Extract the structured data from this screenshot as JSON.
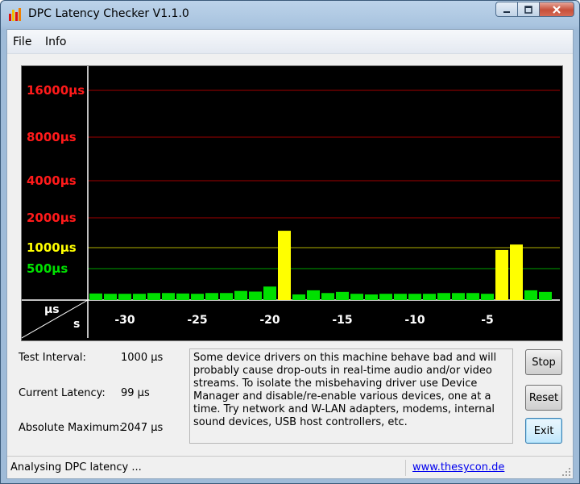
{
  "window": {
    "title": "DPC Latency Checker V1.1.0"
  },
  "menu": {
    "items": [
      "File",
      "Info"
    ]
  },
  "chart_data": {
    "type": "bar",
    "title": "",
    "y_scale": "log",
    "y_tick_labels": [
      "16000µs",
      "8000µs",
      "4000µs",
      "2000µs",
      "1000µs",
      "500µs"
    ],
    "y_ticks": [
      16000,
      8000,
      4000,
      2000,
      1000,
      500
    ],
    "y_tick_colors": [
      "#ff1a1a",
      "#ff1a1a",
      "#ff1a1a",
      "#ff1a1a",
      "#ffff00",
      "#00e000"
    ],
    "x_ticks": [
      -30,
      -25,
      -20,
      -15,
      -10,
      -5
    ],
    "x_tick_labels": [
      "-30",
      "-25",
      "-20",
      "-15",
      "-10",
      "-5"
    ],
    "corner_labels": {
      "y": "µs",
      "x": "s"
    },
    "x": [
      -33,
      -32,
      -31,
      -30,
      -29,
      -28,
      -27,
      -26,
      -25,
      -24,
      -23,
      -22,
      -21,
      -20,
      -19,
      -18,
      -17,
      -16,
      -15,
      -14,
      -13,
      -12,
      -11,
      -10,
      -9,
      -8,
      -7,
      -6,
      -5,
      -4,
      -3,
      -2,
      -1
    ],
    "values": [
      95,
      105,
      100,
      100,
      100,
      112,
      112,
      105,
      100,
      112,
      112,
      145,
      135,
      215,
      1480,
      90,
      155,
      112,
      130,
      100,
      90,
      100,
      100,
      100,
      100,
      112,
      112,
      112,
      100,
      925,
      1075,
      155,
      130,
      100
    ],
    "colors": {
      "normal": "#00e000",
      "warning": "#ffff00",
      "grid_red": "#a00000",
      "grid_yellow": "#b0b000",
      "grid_green": "#00a000",
      "background": "#000000"
    }
  },
  "info": {
    "test_interval_label": "Test Interval:",
    "test_interval_value": "1000 µs",
    "current_latency_label": "Current Latency:",
    "current_latency_value": "99 µs",
    "absolute_maximum_label": "Absolute Maximum:",
    "absolute_maximum_value": "2047 µs"
  },
  "message": "Some device drivers on this machine behave bad and will probably cause drop-outs in real-time audio and/or video streams. To isolate the misbehaving driver use Device Manager and disable/re-enable various devices, one at a time. Try network and W-LAN adapters, modems, internal sound devices, USB host controllers, etc.",
  "buttons": {
    "stop": "Stop",
    "reset": "Reset",
    "exit": "Exit"
  },
  "status": {
    "text": "Analysing DPC latency ...",
    "link": "www.thesycon.de"
  }
}
